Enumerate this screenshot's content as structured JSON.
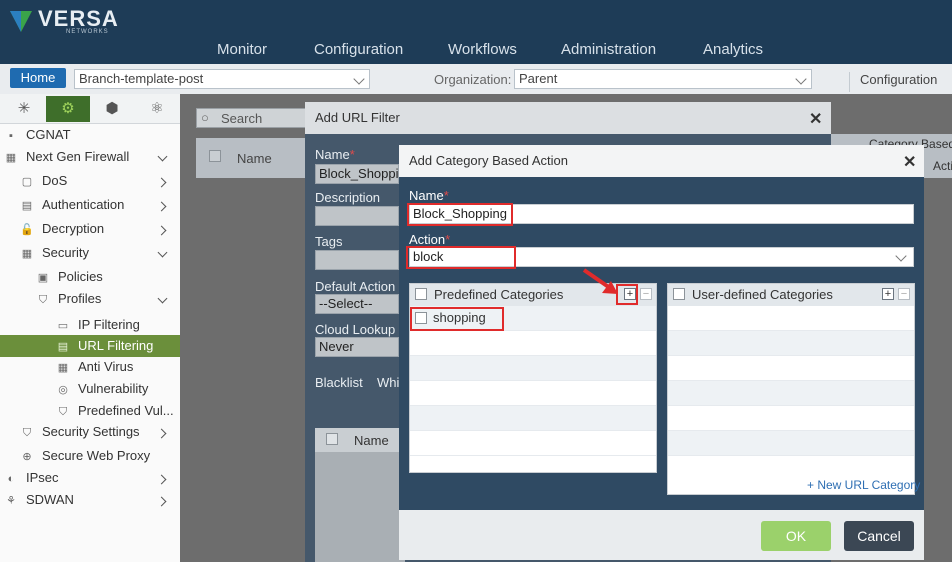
{
  "header": {
    "brand": "VERSA",
    "brand_sub": "NETWORKS",
    "nav": [
      "Monitor",
      "Configuration",
      "Workflows",
      "Administration",
      "Analytics"
    ]
  },
  "toolbar": {
    "home_label": "Home",
    "template_value": "Branch-template-post",
    "org_label": "Organization:",
    "org_value": "Parent",
    "right_label": "Configuration"
  },
  "sidebar": {
    "items": [
      {
        "label": "CGNAT",
        "icon": "cgnat-icon"
      },
      {
        "label": "Next Gen Firewall",
        "icon": "firewall-icon"
      },
      {
        "label": "DoS",
        "icon": "dos-icon"
      },
      {
        "label": "Authentication",
        "icon": "auth-icon"
      },
      {
        "label": "Decryption",
        "icon": "lock-icon"
      },
      {
        "label": "Security",
        "icon": "security-icon"
      },
      {
        "label": "Policies",
        "icon": "policy-icon"
      },
      {
        "label": "Profiles",
        "icon": "shield-icon"
      },
      {
        "label": "IP Filtering",
        "icon": "monitor-icon"
      },
      {
        "label": "URL Filtering",
        "icon": "url-icon"
      },
      {
        "label": "Anti Virus",
        "icon": "virus-icon"
      },
      {
        "label": "Vulnerability",
        "icon": "vuln-icon"
      },
      {
        "label": "Predefined Vul...",
        "icon": "shield-icon"
      },
      {
        "label": "Security Settings",
        "icon": "settings-icon"
      },
      {
        "label": "Secure Web Proxy",
        "icon": "proxy-icon"
      },
      {
        "label": "IPsec",
        "icon": "ipsec-icon"
      },
      {
        "label": "SDWAN",
        "icon": "sdwan-icon"
      }
    ]
  },
  "background": {
    "search_placeholder": "Search",
    "grid_name": "Name"
  },
  "url_filter_dialog": {
    "title": "Add URL Filter",
    "name_label": "Name",
    "name_value": "Block_Shoppin",
    "description_label": "Description",
    "tags_label": "Tags",
    "default_action_label": "Default Action",
    "default_action_value": "--Select--",
    "cloud_lookup_label": "Cloud Lookup M",
    "cloud_lookup_value": "Never",
    "tab_blacklist": "Blacklist",
    "tab_whitelist": "Whi",
    "grid_name": "Name",
    "right_header_1": "Category Based",
    "right_header_2": "Acti"
  },
  "category_dialog": {
    "title": "Add Category Based Action",
    "name_label": "Name",
    "name_value": "Block_Shopping",
    "action_label": "Action",
    "action_value": "block",
    "predefined_header": "Predefined Categories",
    "predefined_rows": [
      "shopping"
    ],
    "user_defined_header": "User-defined Categories",
    "new_category_link": "+ New URL Category",
    "ok_label": "OK",
    "cancel_label": "Cancel"
  },
  "colors": {
    "header_bg": "#1e3c57",
    "dialog_bg": "#2f4a63",
    "highlight_red": "#e02b2b",
    "ok_green": "#9bd16b",
    "sidebar_active": "#6b8f3b"
  }
}
